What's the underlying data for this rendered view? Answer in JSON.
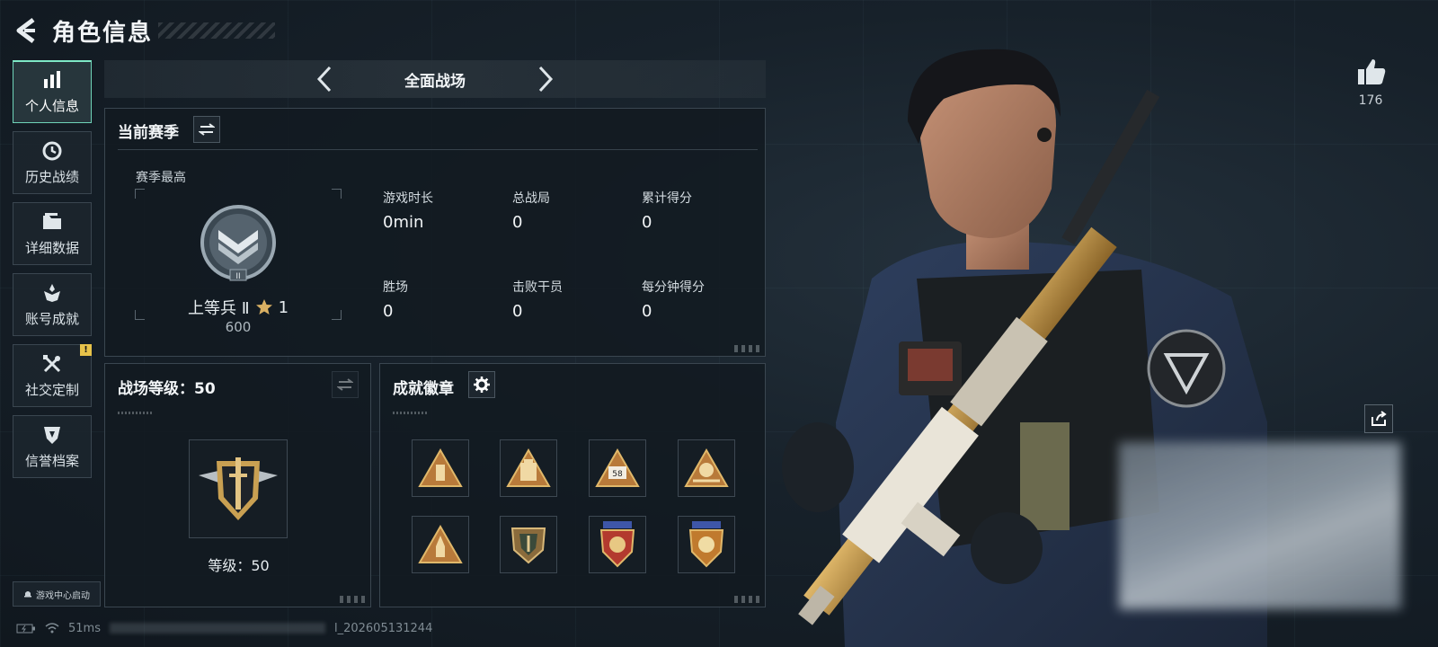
{
  "header": {
    "title": "角色信息"
  },
  "sidebar": {
    "items": [
      {
        "label": "个人信息",
        "icon": "bar-chart-icon",
        "active": true
      },
      {
        "label": "历史战绩",
        "icon": "history-icon"
      },
      {
        "label": "详细数据",
        "icon": "folder-icon"
      },
      {
        "label": "账号成就",
        "icon": "achievement-icon"
      },
      {
        "label": "社交定制",
        "icon": "tools-icon",
        "badge": "!"
      },
      {
        "label": "信誉档案",
        "icon": "credit-shield-icon"
      }
    ],
    "game_center": "游戏中心启动"
  },
  "mode": {
    "title": "全面战场"
  },
  "season": {
    "title": "当前赛季",
    "best_label": "赛季最高",
    "rank_name": "上等兵 Ⅱ",
    "stars": "1",
    "rank_score": "600",
    "stats": [
      {
        "label": "游戏时长",
        "value": "0min"
      },
      {
        "label": "总战局",
        "value": "0"
      },
      {
        "label": "累计得分",
        "value": "0"
      },
      {
        "label": "胜场",
        "value": "0"
      },
      {
        "label": "击败干员",
        "value": "0"
      },
      {
        "label": "每分钟得分",
        "value": "0"
      }
    ]
  },
  "battle_level": {
    "title": "战场等级：50",
    "level_text": "等级：50"
  },
  "badges": {
    "title": "成就徽章",
    "items": [
      "badge-ammo-triangle-icon",
      "badge-backpack-triangle-icon",
      "badge-58-triangle-icon",
      "badge-skull-triangle-icon",
      "badge-rocket-triangle-icon",
      "badge-shield-icon",
      "badge-winged-shield-red-icon",
      "badge-winged-shield-gold-icon"
    ]
  },
  "social": {
    "likes": "176"
  },
  "status": {
    "ping": "51ms",
    "session_id": "l_202605131244"
  },
  "colors": {
    "accent": "#7ee8c6",
    "gold": "#c9a052",
    "panel_border": "#3a4650"
  }
}
